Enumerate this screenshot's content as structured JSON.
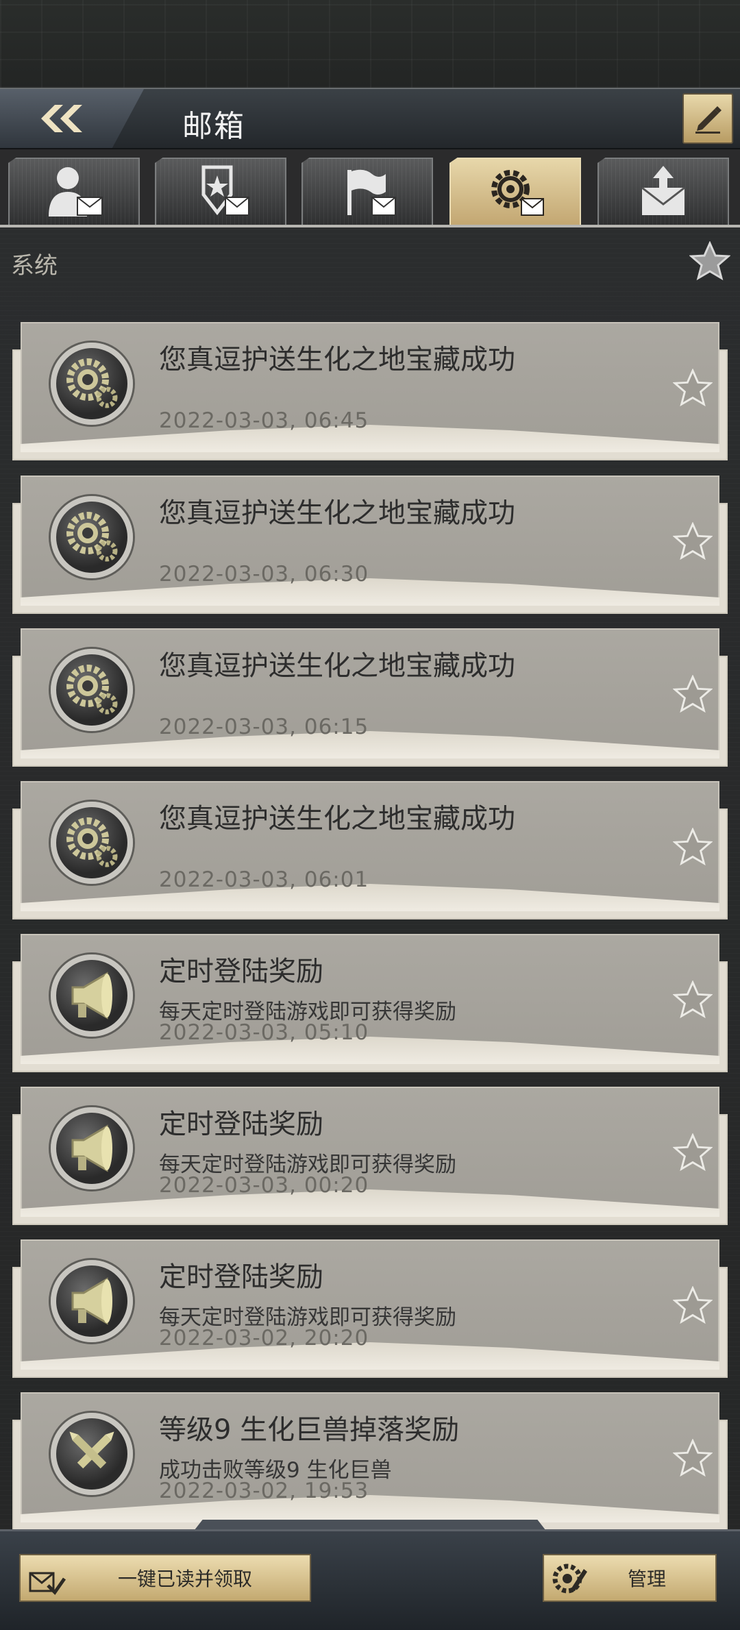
{
  "header": {
    "title": "邮箱"
  },
  "tabs": [
    {
      "id": "personal",
      "icon": "person-mail-icon",
      "active": false
    },
    {
      "id": "alliance",
      "icon": "shield-star-mail-icon",
      "active": false
    },
    {
      "id": "battle",
      "icon": "flag-mail-icon",
      "active": false
    },
    {
      "id": "system",
      "icon": "gear-mail-icon",
      "active": true
    },
    {
      "id": "sent",
      "icon": "outbox-mail-icon",
      "active": false
    }
  ],
  "section": {
    "label": "系统"
  },
  "mails": [
    {
      "title": "您真逗护送生化之地宝藏成功",
      "subtitle": "",
      "time": "2022-03-03, 06:45",
      "icon": "gears-icon"
    },
    {
      "title": "您真逗护送生化之地宝藏成功",
      "subtitle": "",
      "time": "2022-03-03, 06:30",
      "icon": "gears-icon"
    },
    {
      "title": "您真逗护送生化之地宝藏成功",
      "subtitle": "",
      "time": "2022-03-03, 06:15",
      "icon": "gears-icon"
    },
    {
      "title": "您真逗护送生化之地宝藏成功",
      "subtitle": "",
      "time": "2022-03-03, 06:01",
      "icon": "gears-icon"
    },
    {
      "title": "定时登陆奖励",
      "subtitle": "每天定时登陆游戏即可获得奖励",
      "time": "2022-03-03, 05:10",
      "icon": "megaphone-icon"
    },
    {
      "title": "定时登陆奖励",
      "subtitle": "每天定时登陆游戏即可获得奖励",
      "time": "2022-03-03, 00:20",
      "icon": "megaphone-icon"
    },
    {
      "title": "定时登陆奖励",
      "subtitle": "每天定时登陆游戏即可获得奖励",
      "time": "2022-03-02, 20:20",
      "icon": "megaphone-icon"
    },
    {
      "title": "等级9 生化巨兽掉落奖励",
      "subtitle": "成功击败等级9 生化巨兽",
      "time": "2022-03-02, 19:53",
      "icon": "crossed-bullets-icon"
    }
  ],
  "bottom": {
    "read_all_label": "一键已读并领取",
    "manage_label": "管理"
  },
  "colors": {
    "accent_gold": "#c3a772",
    "card_bg": "#a8a59e",
    "text_dark": "#2d2d2d"
  }
}
